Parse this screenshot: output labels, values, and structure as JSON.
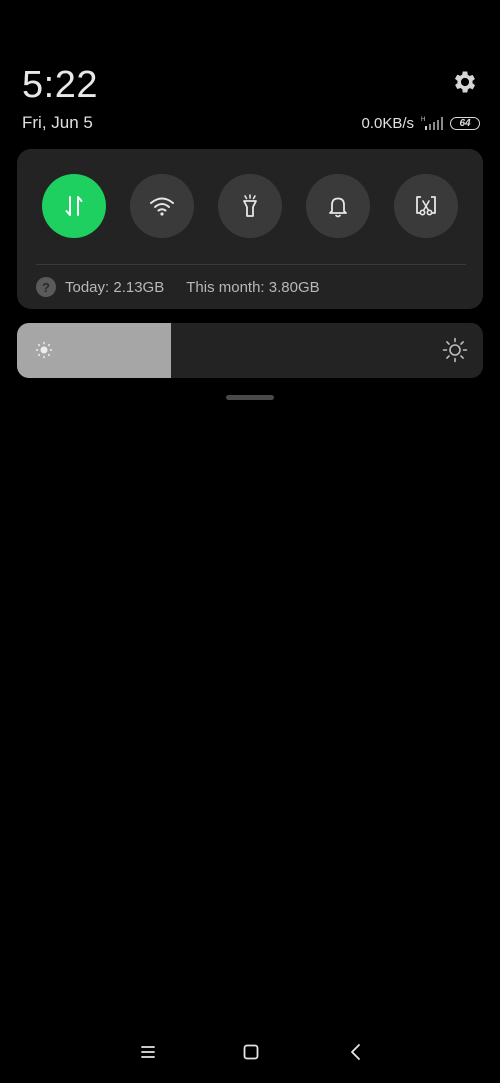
{
  "status": {
    "time": "5:22",
    "date": "Fri, Jun 5",
    "network_speed": "0.0KB/s",
    "signal_type": "H",
    "battery": "64"
  },
  "toggles": [
    {
      "name": "mobile-data",
      "icon": "mobile-data-icon",
      "active": true
    },
    {
      "name": "wifi",
      "icon": "wifi-icon",
      "active": false
    },
    {
      "name": "flashlight",
      "icon": "flashlight-icon",
      "active": false
    },
    {
      "name": "sound",
      "icon": "bell-icon",
      "active": false
    },
    {
      "name": "screenshot",
      "icon": "screenshot-icon",
      "active": false
    }
  ],
  "usage": {
    "today": "Today: 2.13GB",
    "month": "This month: 3.80GB"
  },
  "brightness": {
    "level": 0.33
  },
  "colors": {
    "accent": "#1ed05f",
    "panel": "#232323",
    "toggle_bg": "#3a3a3a",
    "brightness_fill": "#a6a6a6"
  }
}
